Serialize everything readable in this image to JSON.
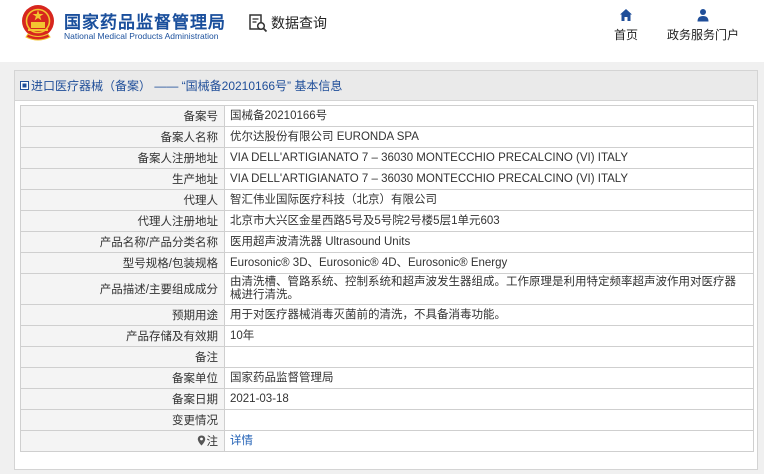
{
  "header": {
    "org_name_cn": "国家药品监督管理局",
    "org_name_en": "National Medical Products Administration",
    "query_label": "数据查询",
    "nav": [
      {
        "label": "首页",
        "icon": "home-icon"
      },
      {
        "label": "政务服务门户",
        "icon": "user-icon"
      }
    ]
  },
  "panel": {
    "title": "进口医疗器械（备案） —— “国械备20210166号” 基本信息"
  },
  "rows": [
    {
      "label": "备案号",
      "value": "国械备20210166号"
    },
    {
      "label": "备案人名称",
      "value": "优尔达股份有限公司 EURONDA SPA"
    },
    {
      "label": "备案人注册地址",
      "value": "VIA DELL'ARTIGIANATO 7 – 36030 MONTECCHIO PRECALCINO (VI) ITALY"
    },
    {
      "label": "生产地址",
      "value": "VIA DELL'ARTIGIANATO 7 – 36030 MONTECCHIO PRECALCINO (VI) ITALY"
    },
    {
      "label": "代理人",
      "value": "智汇伟业国际医疗科技（北京）有限公司"
    },
    {
      "label": "代理人注册地址",
      "value": "北京市大兴区金星西路5号及5号院2号楼5层1单元603"
    },
    {
      "label": "产品名称/产品分类名称",
      "value": "医用超声波清洗器 Ultrasound Units"
    },
    {
      "label": "型号规格/包装规格",
      "value": "Eurosonic® 3D、Eurosonic® 4D、Eurosonic® Energy"
    },
    {
      "label": "产品描述/主要组成成分",
      "value": "由清洗槽、管路系统、控制系统和超声波发生器组成。工作原理是利用特定频率超声波作用对医疗器械进行清洗。"
    },
    {
      "label": "预期用途",
      "value": "用于对医疗器械消毒灭菌前的清洗，不具备消毒功能。"
    },
    {
      "label": "产品存储及有效期",
      "value": "10年"
    },
    {
      "label": "备注",
      "value": ""
    },
    {
      "label": "备案单位",
      "value": "国家药品监督管理局"
    },
    {
      "label": "备案日期",
      "value": "2021-03-18"
    },
    {
      "label": "变更情况",
      "value": ""
    },
    {
      "label": "注",
      "value": "详情"
    }
  ],
  "colors": {
    "brand_blue": "#1a4f9c",
    "emblem_red": "#d7261e",
    "link_blue": "#1f5fb4"
  }
}
